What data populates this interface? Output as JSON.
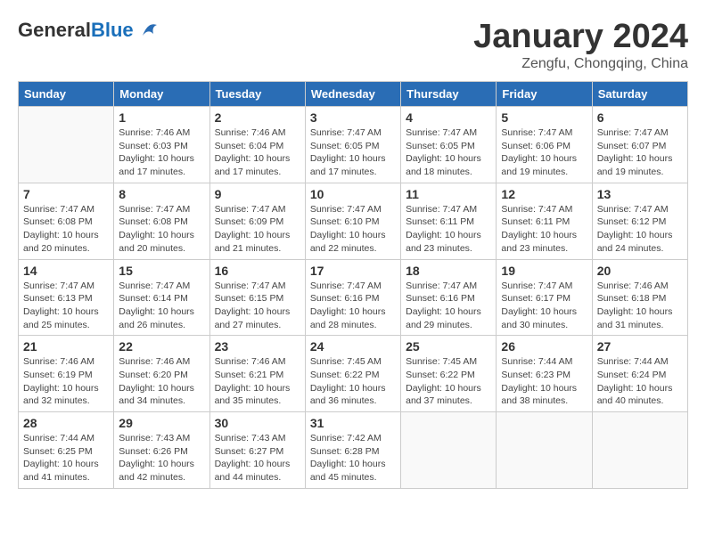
{
  "header": {
    "logo_general": "General",
    "logo_blue": "Blue",
    "month_title": "January 2024",
    "subtitle": "Zengfu, Chongqing, China"
  },
  "weekdays": [
    "Sunday",
    "Monday",
    "Tuesday",
    "Wednesday",
    "Thursday",
    "Friday",
    "Saturday"
  ],
  "weeks": [
    [
      {
        "day": "",
        "empty": true
      },
      {
        "day": "1",
        "rise": "Sunrise: 7:46 AM",
        "set": "Sunset: 6:03 PM",
        "daylight": "Daylight: 10 hours and 17 minutes."
      },
      {
        "day": "2",
        "rise": "Sunrise: 7:46 AM",
        "set": "Sunset: 6:04 PM",
        "daylight": "Daylight: 10 hours and 17 minutes."
      },
      {
        "day": "3",
        "rise": "Sunrise: 7:47 AM",
        "set": "Sunset: 6:05 PM",
        "daylight": "Daylight: 10 hours and 17 minutes."
      },
      {
        "day": "4",
        "rise": "Sunrise: 7:47 AM",
        "set": "Sunset: 6:05 PM",
        "daylight": "Daylight: 10 hours and 18 minutes."
      },
      {
        "day": "5",
        "rise": "Sunrise: 7:47 AM",
        "set": "Sunset: 6:06 PM",
        "daylight": "Daylight: 10 hours and 19 minutes."
      },
      {
        "day": "6",
        "rise": "Sunrise: 7:47 AM",
        "set": "Sunset: 6:07 PM",
        "daylight": "Daylight: 10 hours and 19 minutes."
      }
    ],
    [
      {
        "day": "7",
        "rise": "Sunrise: 7:47 AM",
        "set": "Sunset: 6:08 PM",
        "daylight": "Daylight: 10 hours and 20 minutes."
      },
      {
        "day": "8",
        "rise": "Sunrise: 7:47 AM",
        "set": "Sunset: 6:08 PM",
        "daylight": "Daylight: 10 hours and 20 minutes."
      },
      {
        "day": "9",
        "rise": "Sunrise: 7:47 AM",
        "set": "Sunset: 6:09 PM",
        "daylight": "Daylight: 10 hours and 21 minutes."
      },
      {
        "day": "10",
        "rise": "Sunrise: 7:47 AM",
        "set": "Sunset: 6:10 PM",
        "daylight": "Daylight: 10 hours and 22 minutes."
      },
      {
        "day": "11",
        "rise": "Sunrise: 7:47 AM",
        "set": "Sunset: 6:11 PM",
        "daylight": "Daylight: 10 hours and 23 minutes."
      },
      {
        "day": "12",
        "rise": "Sunrise: 7:47 AM",
        "set": "Sunset: 6:11 PM",
        "daylight": "Daylight: 10 hours and 23 minutes."
      },
      {
        "day": "13",
        "rise": "Sunrise: 7:47 AM",
        "set": "Sunset: 6:12 PM",
        "daylight": "Daylight: 10 hours and 24 minutes."
      }
    ],
    [
      {
        "day": "14",
        "rise": "Sunrise: 7:47 AM",
        "set": "Sunset: 6:13 PM",
        "daylight": "Daylight: 10 hours and 25 minutes."
      },
      {
        "day": "15",
        "rise": "Sunrise: 7:47 AM",
        "set": "Sunset: 6:14 PM",
        "daylight": "Daylight: 10 hours and 26 minutes."
      },
      {
        "day": "16",
        "rise": "Sunrise: 7:47 AM",
        "set": "Sunset: 6:15 PM",
        "daylight": "Daylight: 10 hours and 27 minutes."
      },
      {
        "day": "17",
        "rise": "Sunrise: 7:47 AM",
        "set": "Sunset: 6:16 PM",
        "daylight": "Daylight: 10 hours and 28 minutes."
      },
      {
        "day": "18",
        "rise": "Sunrise: 7:47 AM",
        "set": "Sunset: 6:16 PM",
        "daylight": "Daylight: 10 hours and 29 minutes."
      },
      {
        "day": "19",
        "rise": "Sunrise: 7:47 AM",
        "set": "Sunset: 6:17 PM",
        "daylight": "Daylight: 10 hours and 30 minutes."
      },
      {
        "day": "20",
        "rise": "Sunrise: 7:46 AM",
        "set": "Sunset: 6:18 PM",
        "daylight": "Daylight: 10 hours and 31 minutes."
      }
    ],
    [
      {
        "day": "21",
        "rise": "Sunrise: 7:46 AM",
        "set": "Sunset: 6:19 PM",
        "daylight": "Daylight: 10 hours and 32 minutes."
      },
      {
        "day": "22",
        "rise": "Sunrise: 7:46 AM",
        "set": "Sunset: 6:20 PM",
        "daylight": "Daylight: 10 hours and 34 minutes."
      },
      {
        "day": "23",
        "rise": "Sunrise: 7:46 AM",
        "set": "Sunset: 6:21 PM",
        "daylight": "Daylight: 10 hours and 35 minutes."
      },
      {
        "day": "24",
        "rise": "Sunrise: 7:45 AM",
        "set": "Sunset: 6:22 PM",
        "daylight": "Daylight: 10 hours and 36 minutes."
      },
      {
        "day": "25",
        "rise": "Sunrise: 7:45 AM",
        "set": "Sunset: 6:22 PM",
        "daylight": "Daylight: 10 hours and 37 minutes."
      },
      {
        "day": "26",
        "rise": "Sunrise: 7:44 AM",
        "set": "Sunset: 6:23 PM",
        "daylight": "Daylight: 10 hours and 38 minutes."
      },
      {
        "day": "27",
        "rise": "Sunrise: 7:44 AM",
        "set": "Sunset: 6:24 PM",
        "daylight": "Daylight: 10 hours and 40 minutes."
      }
    ],
    [
      {
        "day": "28",
        "rise": "Sunrise: 7:44 AM",
        "set": "Sunset: 6:25 PM",
        "daylight": "Daylight: 10 hours and 41 minutes."
      },
      {
        "day": "29",
        "rise": "Sunrise: 7:43 AM",
        "set": "Sunset: 6:26 PM",
        "daylight": "Daylight: 10 hours and 42 minutes."
      },
      {
        "day": "30",
        "rise": "Sunrise: 7:43 AM",
        "set": "Sunset: 6:27 PM",
        "daylight": "Daylight: 10 hours and 44 minutes."
      },
      {
        "day": "31",
        "rise": "Sunrise: 7:42 AM",
        "set": "Sunset: 6:28 PM",
        "daylight": "Daylight: 10 hours and 45 minutes."
      },
      {
        "day": "",
        "empty": true
      },
      {
        "day": "",
        "empty": true
      },
      {
        "day": "",
        "empty": true
      }
    ]
  ]
}
